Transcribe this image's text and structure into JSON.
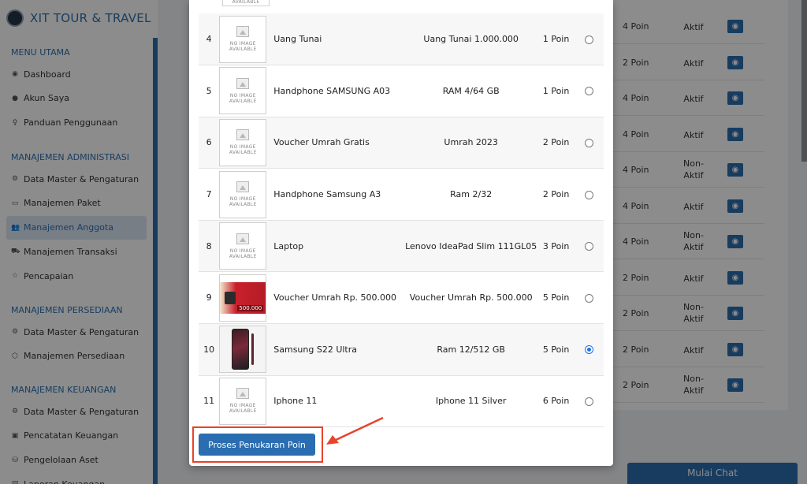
{
  "brand": {
    "name": "XIT TOUR & TRAVEL"
  },
  "sidebar": {
    "sections": [
      {
        "title": "MENU UTAMA",
        "items": [
          {
            "label": "Dashboard",
            "icon": "dashboard-icon",
            "glyph": "◉"
          },
          {
            "label": "Akun Saya",
            "icon": "user-icon",
            "glyph": "●"
          },
          {
            "label": "Panduan Penggunaan",
            "icon": "bulb-icon",
            "glyph": "♀"
          }
        ]
      },
      {
        "title": "MANAJEMEN ADMINISTRASI",
        "items": [
          {
            "label": "Data Master & Pengaturan",
            "icon": "gears-icon",
            "glyph": "⚙"
          },
          {
            "label": "Manajemen Paket",
            "icon": "package-icon",
            "glyph": "▭"
          },
          {
            "label": "Manajemen Anggota",
            "icon": "users-icon",
            "glyph": "👥",
            "active": true
          },
          {
            "label": "Manajemen Transaksi",
            "icon": "cart-icon",
            "glyph": "⛟"
          },
          {
            "label": "Pencapaian",
            "icon": "star-icon",
            "glyph": "☆"
          }
        ]
      },
      {
        "title": "MANAJEMEN PERSEDIAAN",
        "items": [
          {
            "label": "Data Master & Pengaturan",
            "icon": "gears-icon",
            "glyph": "⚙"
          },
          {
            "label": "Manajemen Persediaan",
            "icon": "cubes-icon",
            "glyph": "⬡"
          }
        ]
      },
      {
        "title": "MANAJEMEN KEUANGAN",
        "items": [
          {
            "label": "Data Master & Pengaturan",
            "icon": "gears-icon",
            "glyph": "⚙"
          },
          {
            "label": "Pencatatan Keuangan",
            "icon": "money-icon",
            "glyph": "▣"
          },
          {
            "label": "Pengelolaan Aset",
            "icon": "database-icon",
            "glyph": "⛁"
          },
          {
            "label": "Laporan Keuangan",
            "icon": "report-icon",
            "glyph": "▤"
          }
        ]
      }
    ]
  },
  "background_table": {
    "rows": [
      {
        "poin": "4 Poin",
        "status": "Aktif"
      },
      {
        "poin": "2 Poin",
        "status": "Aktif"
      },
      {
        "poin": "4 Poin",
        "status": "Aktif"
      },
      {
        "poin": "4 Poin",
        "status": "Aktif"
      },
      {
        "poin": "4 Poin",
        "status": "Non-\nAktif"
      },
      {
        "poin": "4 Poin",
        "status": "Aktif"
      },
      {
        "poin": "4 Poin",
        "status": "Non-\nAktif"
      },
      {
        "poin": "2 Poin",
        "status": "Aktif"
      },
      {
        "poin": "2 Poin",
        "status": "Non-\nAktif"
      },
      {
        "poin": "2 Poin",
        "status": "Aktif"
      },
      {
        "poin": "2 Poin",
        "status": "Non-\nAktif"
      }
    ]
  },
  "chat_button": {
    "label": "Mulai Chat"
  },
  "modal": {
    "partial_top_image_text": "AVAILABLE",
    "no_image_text": "NO IMAGE\nAVAILABLE",
    "voucher_amount": "500.000",
    "rows": [
      {
        "no": "4",
        "name": "Uang Tunai",
        "spec": "Uang Tunai 1.000.000",
        "poin": "1 Poin",
        "image": "none",
        "selected": false
      },
      {
        "no": "5",
        "name": "Handphone SAMSUNG A03",
        "spec": "RAM 4/64 GB",
        "poin": "1 Poin",
        "image": "none",
        "selected": false
      },
      {
        "no": "6",
        "name": "Voucher Umrah Gratis",
        "spec": "Umrah 2023",
        "poin": "2 Poin",
        "image": "none",
        "selected": false
      },
      {
        "no": "7",
        "name": "Handphone Samsung A3",
        "spec": "Ram 2/32",
        "poin": "2 Poin",
        "image": "none",
        "selected": false
      },
      {
        "no": "8",
        "name": "Laptop",
        "spec": "Lenovo IdeaPad Slim 111GL05",
        "poin": "3 Poin",
        "image": "none",
        "selected": false
      },
      {
        "no": "9",
        "name": "Voucher Umrah Rp. 500.000",
        "spec": "Voucher Umrah Rp. 500.000",
        "poin": "5 Poin",
        "image": "voucher",
        "selected": false
      },
      {
        "no": "10",
        "name": "Samsung S22 Ultra",
        "spec": "Ram 12/512 GB",
        "poin": "5 Poin",
        "image": "phone",
        "selected": true
      },
      {
        "no": "11",
        "name": "Iphone 11",
        "spec": "Iphone 11 Silver",
        "poin": "6 Poin",
        "image": "none",
        "selected": false
      }
    ],
    "submit_label": "Proses Penukaran Poin",
    "highlight_color": "#e8432b"
  }
}
